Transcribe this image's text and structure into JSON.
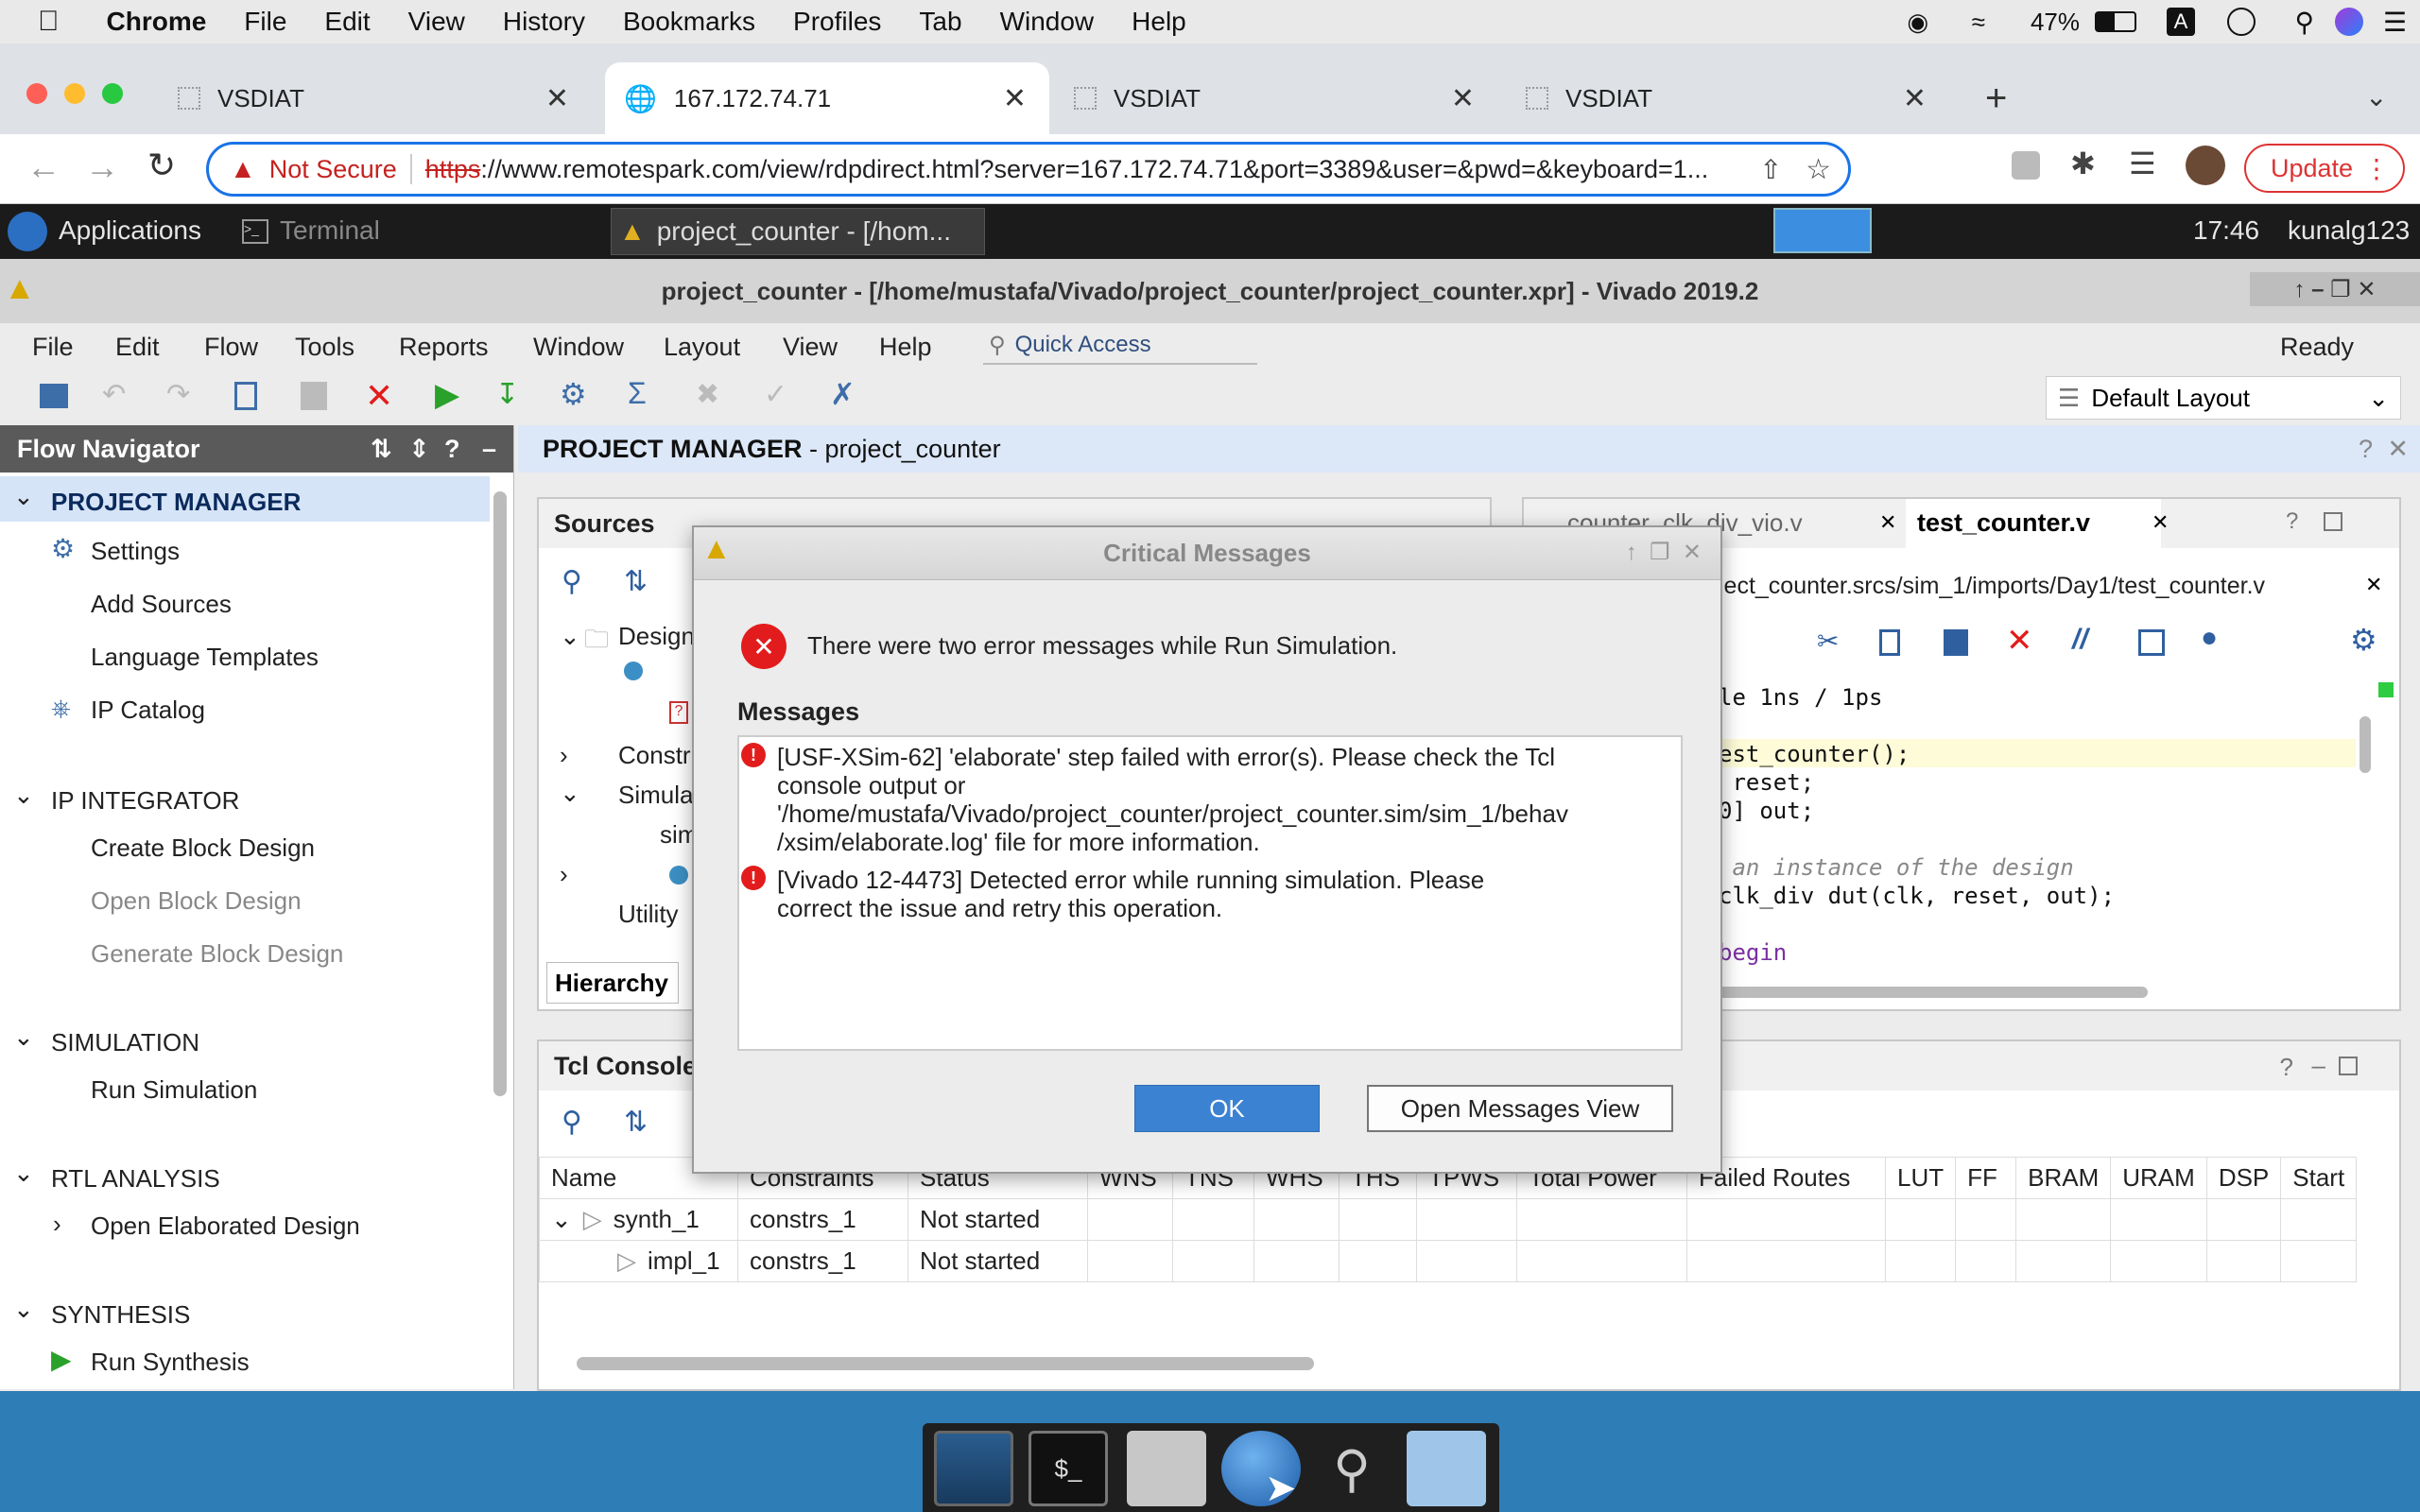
{
  "mac_menubar": {
    "app": "Chrome",
    "items": [
      "File",
      "Edit",
      "View",
      "History",
      "Bookmarks",
      "Profiles",
      "Tab",
      "Window",
      "Help"
    ],
    "battery": "47%"
  },
  "browser": {
    "tabs": [
      {
        "label": "VSDIAT"
      },
      {
        "label": "167.172.74.71"
      },
      {
        "label": "VSDIAT"
      },
      {
        "label": "VSDIAT"
      }
    ],
    "security": "Not Secure",
    "url_scheme": "https",
    "url_rest": "://www.remotespark.com/view/rdpdirect.html?server=167.172.74.71&port=3389&user=&pwd=&keyboard=1...",
    "update_label": "Update"
  },
  "xfce_panel": {
    "applications": "Applications",
    "terminal": "Terminal",
    "window_task": "project_counter - [/hom...",
    "clock": "17:46",
    "user": "kunalg123"
  },
  "vivado": {
    "title": "project_counter - [/home/mustafa/Vivado/project_counter/project_counter.xpr] - Vivado 2019.2",
    "menu": [
      "File",
      "Edit",
      "Flow",
      "Tools",
      "Reports",
      "Window",
      "Layout",
      "View",
      "Help"
    ],
    "quick_access": "Quick Access",
    "status": "Ready",
    "layout": "Default Layout",
    "flow_navigator": {
      "title": "Flow Navigator",
      "project_manager": "PROJECT MANAGER",
      "settings": "Settings",
      "add_sources": "Add Sources",
      "language_templates": "Language Templates",
      "ip_catalog": "IP Catalog",
      "ip_integrator": "IP INTEGRATOR",
      "create_bd": "Create Block Design",
      "open_bd": "Open Block Design",
      "generate_bd": "Generate Block Design",
      "simulation": "SIMULATION",
      "run_sim": "Run Simulation",
      "rtl": "RTL ANALYSIS",
      "open_elab": "Open Elaborated Design",
      "synthesis": "SYNTHESIS",
      "run_synth": "Run Synthesis"
    },
    "pm_header_bold": "PROJECT MANAGER",
    "pm_header_rest": " - project_counter",
    "sources": {
      "title": "Sources",
      "items": [
        "Design",
        "Constr",
        "Simula",
        "sim",
        "Utility"
      ],
      "hierarchy_tab": "Hierarchy"
    },
    "editor": {
      "tab_inactive": "counter_clk_div_vio.v",
      "tab_active": "test_counter.v",
      "path": "ject_counter.srcs/sim_1/imports/Day1/test_counter.v",
      "lines": [
        "le 1ns / 1ps",
        "",
        "est_counter();",
        " reset;",
        "0] out;",
        "",
        " an instance of the design",
        "clk_div dut(clk, reset, out);",
        "",
        "begin"
      ]
    },
    "tcl": {
      "title": "Tcl Console"
    },
    "runs_table": {
      "headers": [
        "Name",
        "Constraints",
        "Status",
        "WNS",
        "TNS",
        "WHS",
        "THS",
        "TPWS",
        "Total Power",
        "Failed Routes",
        "LUT",
        "FF",
        "BRAM",
        "URAM",
        "DSP",
        "Start"
      ],
      "rows": [
        [
          "synth_1",
          "constrs_1",
          "Not started"
        ],
        [
          "impl_1",
          "constrs_1",
          "Not started"
        ]
      ]
    }
  },
  "dialog": {
    "title": "Critical Messages",
    "summary": "There were two error messages while Run Simulation.",
    "messages_label": "Messages",
    "messages": [
      [
        "[USF-XSim-62] 'elaborate' step failed with error(s). Please check the Tcl",
        "console output or",
        "'/home/mustafa/Vivado/project_counter/project_counter.sim/sim_1/behav",
        "/xsim/elaborate.log' file for more information."
      ],
      [
        "[Vivado 12-4473] Detected error while running simulation. Please",
        "correct the issue and retry this operation."
      ]
    ],
    "ok": "OK",
    "open_view": "Open Messages View"
  },
  "colors": {
    "accent": "#1a73e8",
    "error": "#e21c1c",
    "vivado_button": "#3c82d2",
    "desktop": "#2f7db6"
  }
}
